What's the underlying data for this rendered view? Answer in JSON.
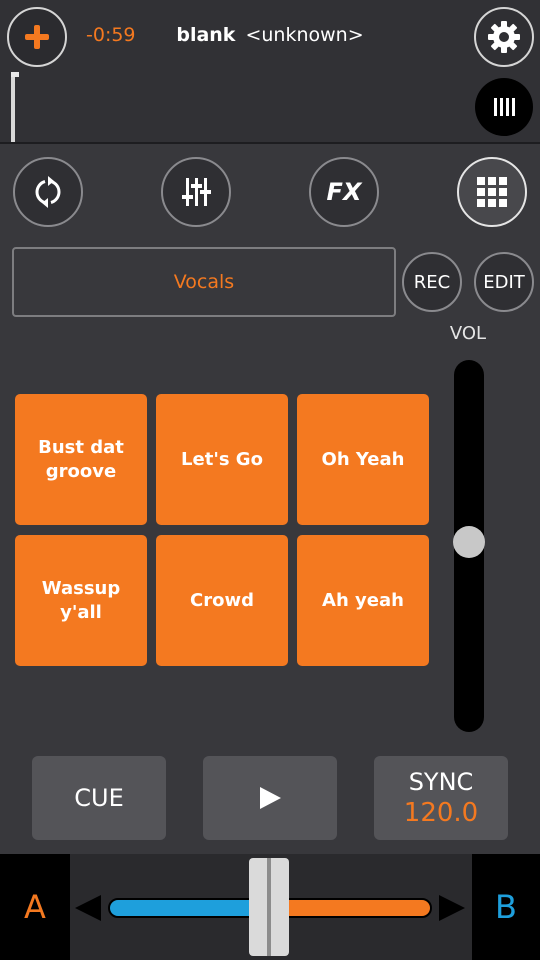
{
  "header": {
    "time_remaining": "-0:59",
    "track_title": "blank",
    "track_artist": "<unknown>"
  },
  "toolbar": {
    "loop_icon": "loop-icon",
    "mixer_icon": "eq-sliders-icon",
    "fx_label": "FX",
    "sampler_icon": "grid-icon"
  },
  "sampler": {
    "bank_name": "Vocals",
    "rec_label": "REC",
    "edit_label": "EDIT",
    "pads": [
      "Bust dat groove",
      "Let's Go",
      "Oh Yeah",
      "Wassup y'all",
      "Crowd",
      "Ah yeah"
    ]
  },
  "volume": {
    "label": "VOL",
    "level": 0.5
  },
  "transport": {
    "cue_label": "CUE",
    "sync_label": "SYNC",
    "bpm": "120.0"
  },
  "crossfader": {
    "deck_a": "A",
    "deck_b": "B",
    "position": 0.5
  },
  "colors": {
    "accent_orange": "#f47920",
    "accent_blue": "#1e9fdc"
  }
}
